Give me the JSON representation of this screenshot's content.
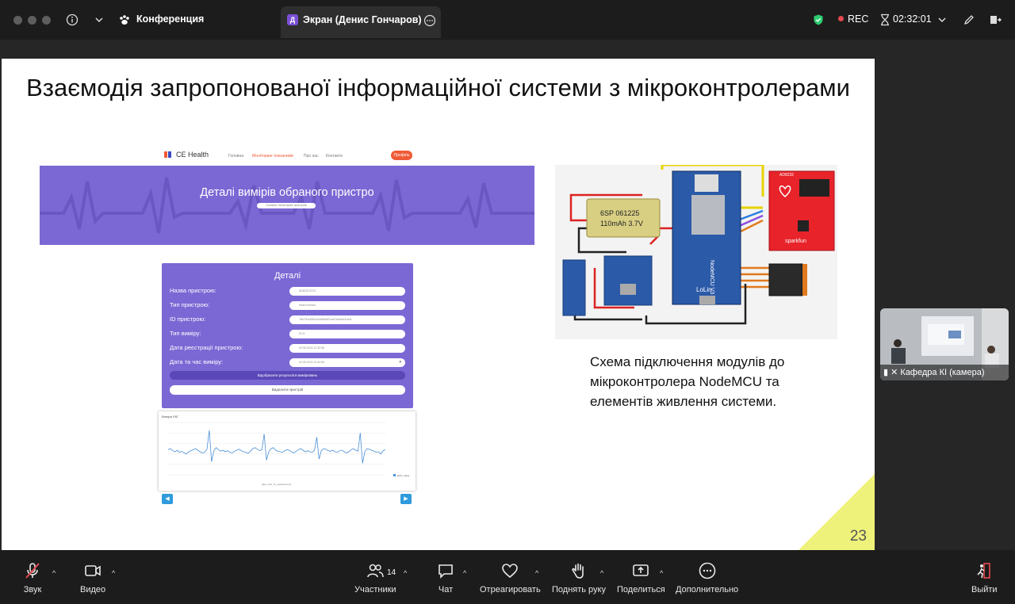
{
  "topbar": {
    "meeting_label": "Конференция",
    "screen_tab_label": "Экран (Денис Гончаров)",
    "screen_avatar_letter": "Д",
    "rec_label": "REC",
    "timer": "02:32:01"
  },
  "slide": {
    "title": "Взаємодія запропонованої інформаційної системи з мікроконтролерами",
    "caption": "Схема підключення модулів до мікроконтролера NodeMCU та елементів живлення системи.",
    "page_number": "23"
  },
  "webpage": {
    "logo": "CE Health",
    "nav_links": [
      "Головна",
      "Моніторинг показників",
      "Про нас",
      "Контакти"
    ],
    "nav_button": "Профіль",
    "hero_title": "Деталі вимірів обраного пристро",
    "hero_crumb": "Головна / Моніторинг пристроїв",
    "details_title": "Деталі",
    "fields": [
      {
        "label": "Назва пристрою:",
        "value": "AD8232 ECG"
      },
      {
        "label": "Тип пристрою:",
        "value": "Heart monitor"
      },
      {
        "label": "ID пристрою:",
        "value": "78e7f1ed2f9c4a3d8b6f21ca07e5a4b3c9d1"
      },
      {
        "label": "Тип виміру:",
        "value": "ECG"
      },
      {
        "label": "Дата реєстрації пристрою:",
        "value": "02.06.2024 11:33:36"
      },
      {
        "label": "Дата та час виміру:",
        "value": "02.06.2024 11:44:09"
      }
    ],
    "btn_show": "Відобразити результати вимірювань",
    "btn_delete": "Видалити пристрій",
    "chart_title": "Виміри ЕКГ",
    "chart_xlabel": "date_time_of_measurement",
    "chart_legend": "ECG_value"
  },
  "schematic": {
    "battery_line1": "6SP 061225",
    "battery_line2": "110mAh 3.7V",
    "board_label": "NodeMCU V3",
    "board_sub": "LoLin",
    "sensor_label": "AD8232",
    "sensor_brand": "sparkfun"
  },
  "participant": {
    "label": "Кафедра КІ (камера)"
  },
  "toolbar": {
    "audio": "Звук",
    "video": "Видео",
    "participants": "Участники",
    "participants_count": "14",
    "chat": "Чат",
    "react": "Отреагировать",
    "raise_hand": "Поднять руку",
    "share": "Поделиться",
    "more": "Дополнительно",
    "leave": "Выйти"
  },
  "chart_data": {
    "type": "line",
    "title": "Виміри ЕКГ",
    "xlabel": "date_time_of_measurement",
    "ylabel": "",
    "ylim": [
      0,
      100
    ],
    "series": [
      {
        "name": "ECG_value",
        "values": [
          48,
          50,
          46,
          44,
          47,
          43,
          45,
          42,
          40,
          44,
          46,
          48,
          50,
          47,
          44,
          42,
          43,
          49,
          85,
          25,
          46,
          52,
          48,
          45,
          47,
          44,
          46,
          43,
          42,
          45,
          47,
          49,
          46,
          44,
          43,
          41,
          45,
          50,
          52,
          49,
          46,
          48,
          78,
          28,
          44,
          50,
          52,
          47,
          45,
          44,
          43,
          46,
          48,
          47,
          44,
          42,
          45,
          48,
          50,
          47,
          44,
          46,
          44,
          43,
          47,
          72,
          30,
          46,
          50,
          49,
          46,
          45,
          47,
          44,
          43,
          46,
          47,
          44,
          42,
          44,
          48,
          50,
          47,
          45,
          80,
          22,
          44,
          50,
          49,
          47,
          45,
          43,
          44,
          40,
          46,
          48
        ]
      }
    ]
  }
}
